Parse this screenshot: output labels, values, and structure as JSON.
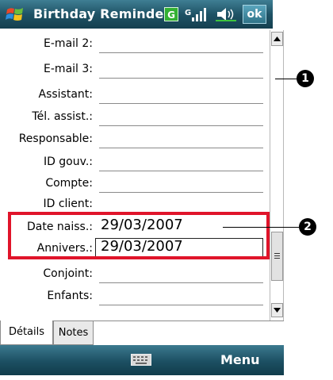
{
  "titlebar": {
    "app_title": "Birthday Reminder",
    "badge_letter": "G",
    "ok_label": "ok"
  },
  "fields": [
    {
      "label": "E-mail 2:",
      "value": ""
    },
    {
      "label": "E-mail 3:",
      "value": ""
    },
    {
      "label": "Assistant:",
      "value": ""
    },
    {
      "label": "Tél. assist.:",
      "value": ""
    },
    {
      "label": "Responsable:",
      "value": ""
    },
    {
      "label": "ID gouv.:",
      "value": ""
    },
    {
      "label": "Compte:",
      "value": ""
    },
    {
      "label": "ID client:",
      "value": ""
    },
    {
      "label": "Date naiss.:",
      "value": "29/03/2007"
    },
    {
      "label": "Annivers.:",
      "value": "29/03/2007"
    },
    {
      "label": "Conjoint:",
      "value": ""
    },
    {
      "label": "Enfants:",
      "value": ""
    }
  ],
  "callouts": {
    "one": "1",
    "two": "2"
  },
  "tabs": [
    {
      "label": "Détails"
    },
    {
      "label": "Notes"
    }
  ],
  "menubar": {
    "menu_label": "Menu"
  },
  "colors": {
    "highlight": "#e0142a",
    "bar": "#1f5366",
    "ok": "#3b8aa2"
  }
}
